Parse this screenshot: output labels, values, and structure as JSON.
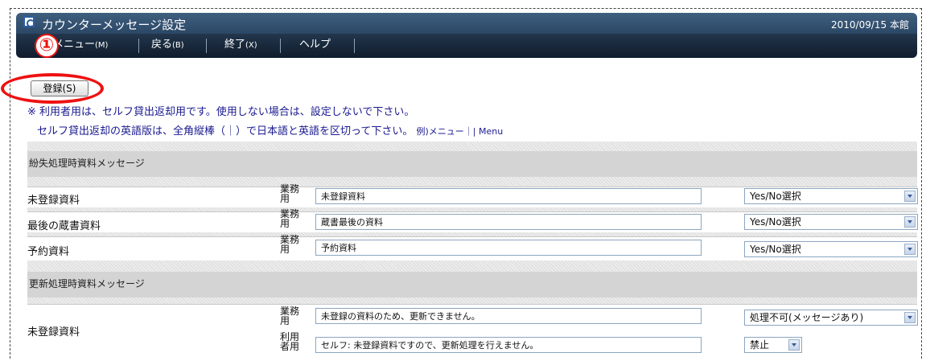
{
  "window": {
    "title": "カウンターメッセージ設定",
    "date_location": "2010/09/15 本館"
  },
  "menubar": {
    "items": [
      {
        "label": "メニュー",
        "key": "(M)"
      },
      {
        "label": "戻る",
        "key": "(B)"
      },
      {
        "label": "終了",
        "key": "(X)"
      },
      {
        "label": "ヘルプ",
        "key": ""
      }
    ]
  },
  "annotation": {
    "marker": "①"
  },
  "toolbar": {
    "register_label": "登録(S)"
  },
  "notes": {
    "line1": "※ 利用者用は、セルフ貸出返却用です。使用しない場合は、設定しないで下さい。",
    "line2": "セルフ貸出返却の英語版は、全角縦棒（｜）で日本語と英語を区切って下さい。",
    "example": "例)メニュー｜| Menu"
  },
  "sections": [
    {
      "title": "紛失処理時資料メッセージ",
      "rows": [
        {
          "label": "未登録資料",
          "usage": "業務用",
          "text": "未登録資料",
          "select": "Yes/No選択"
        },
        {
          "label": "最後の蔵書資料",
          "usage": "業務用",
          "text": "蔵書最後の資料",
          "select": "Yes/No選択"
        },
        {
          "label": "予約資料",
          "usage": "業務用",
          "text": "予約資料",
          "select": "Yes/No選択"
        }
      ]
    },
    {
      "title": "更新処理時資料メッセージ",
      "rows": [
        {
          "label": "未登録資料",
          "usage": "業務用",
          "text": "未登録の資料のため、更新できません。",
          "select": "処理不可(メッセージあり)"
        },
        {
          "label": "",
          "usage": "利用者用",
          "text": "セルフ: 未登録資料ですので、更新処理を行えません。",
          "select": "禁止"
        }
      ]
    }
  ]
}
